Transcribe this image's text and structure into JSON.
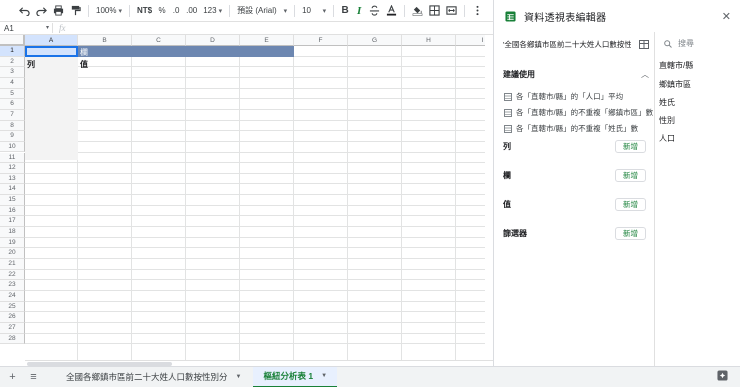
{
  "toolbar": {
    "zoom": "100%",
    "currency": "NT$",
    "percent": "%",
    "dec_decrease": ".0",
    "dec_increase": ".00",
    "number_format": "123",
    "font": "預設 (Arial)",
    "font_size": "10",
    "bold": "B",
    "italic": "I"
  },
  "formula_bar": {
    "cell_ref": "A1",
    "fx": "fx"
  },
  "grid": {
    "columns": [
      "A",
      "B",
      "C",
      "D",
      "E",
      "F",
      "G",
      "H",
      "I"
    ],
    "rows": [
      "1",
      "2",
      "3",
      "4",
      "5",
      "6",
      "7",
      "8",
      "9",
      "10",
      "11",
      "12",
      "13",
      "14",
      "15",
      "16",
      "17",
      "18",
      "19",
      "20",
      "21",
      "22",
      "23",
      "24",
      "25",
      "26",
      "27",
      "28"
    ],
    "cells": {
      "b1": "欄",
      "a2": "列",
      "b2": "值"
    }
  },
  "sheets": {
    "tabs": [
      {
        "label": "全國各鄉鎮市區前二十大姓人口數按性別分",
        "active": false
      },
      {
        "label": "樞紐分析表 1",
        "active": true
      }
    ]
  },
  "editor": {
    "title": "資料透視表編輯器",
    "range": "'全國各鄉鎮市區前二十大姓人口數按性別分",
    "suggestions_title": "建議使用",
    "suggestions": [
      "各「直轄市/縣」的「人口」平均",
      "各「直轄市/縣」的不重複「鄉鎮市區」數",
      "各「直轄市/縣」的不重複「姓氏」數"
    ],
    "sections": [
      {
        "label": "列",
        "button": "新增"
      },
      {
        "label": "欄",
        "button": "新增"
      },
      {
        "label": "值",
        "button": "新增"
      },
      {
        "label": "篩選器",
        "button": "新增"
      }
    ],
    "search_placeholder": "搜尋",
    "fields": [
      "直轄市/縣",
      "鄉鎮市區",
      "姓氏",
      "性別",
      "人口"
    ]
  },
  "colors": {
    "accent_green": "#188038",
    "header_fill": "#6d87b1",
    "selection_blue": "#1a73e8"
  }
}
